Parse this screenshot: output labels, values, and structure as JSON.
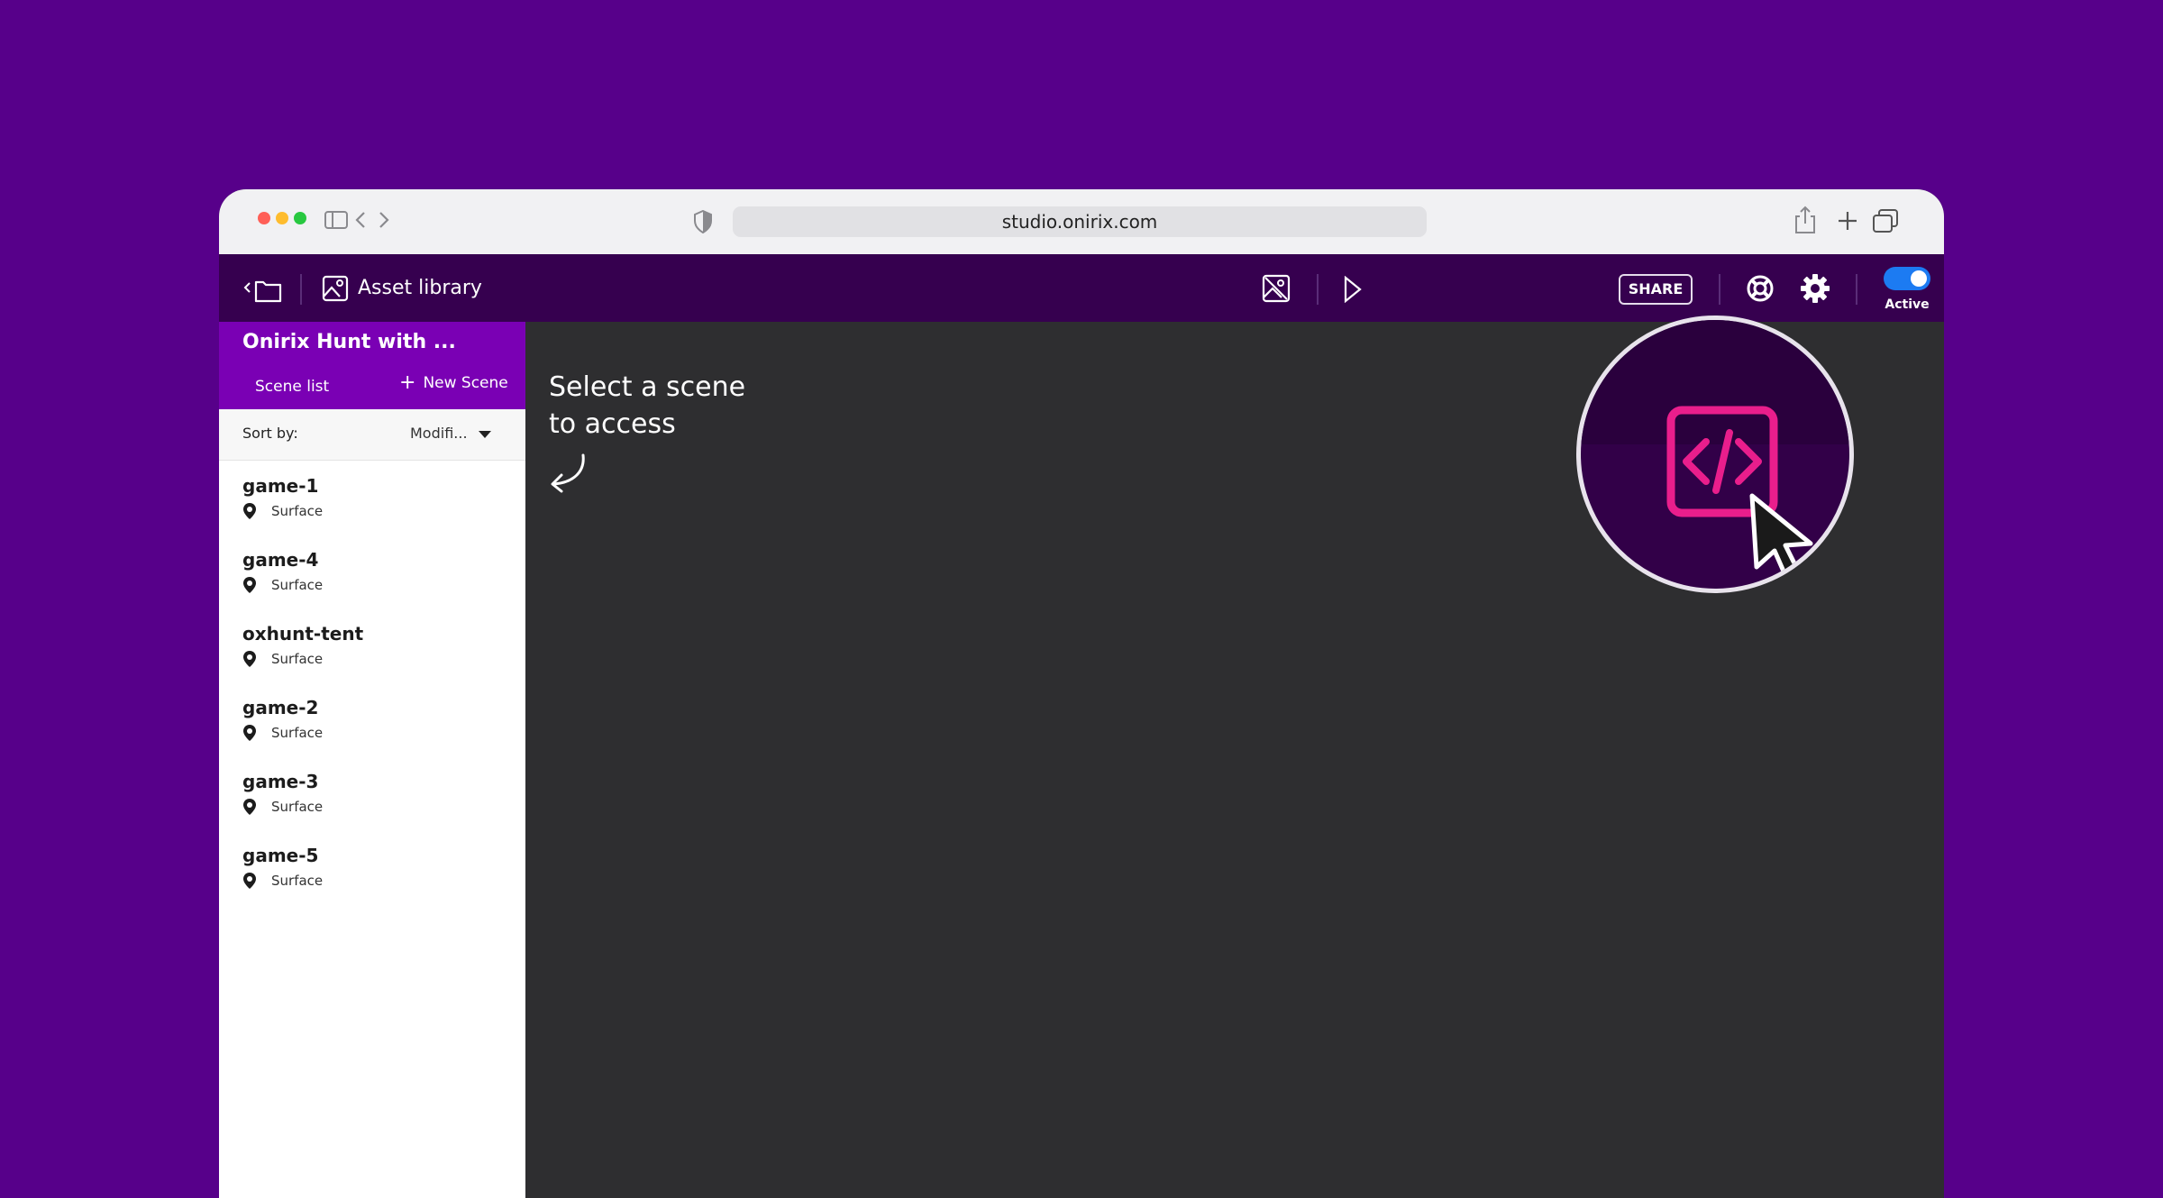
{
  "browser": {
    "url": "studio.onirix.com",
    "traffic_lights": [
      "#ff5f57",
      "#febc2e",
      "#28c840"
    ]
  },
  "toolbar": {
    "asset_library_label": "Asset library",
    "share_label": "SHARE",
    "active_toggle": {
      "label": "Active",
      "on": true
    }
  },
  "sidebar": {
    "project_title": "Onirix Hunt with ...",
    "scene_list_label": "Scene list",
    "new_scene_label": "New Scene",
    "sort_label": "Sort by:",
    "sort_value": "Modifi...",
    "scenes": [
      {
        "name": "game-1",
        "type": "Surface"
      },
      {
        "name": "game-4",
        "type": "Surface"
      },
      {
        "name": "oxhunt-tent",
        "type": "Surface"
      },
      {
        "name": "game-2",
        "type": "Surface"
      },
      {
        "name": "game-3",
        "type": "Surface"
      },
      {
        "name": "game-5",
        "type": "Surface"
      }
    ]
  },
  "main": {
    "hint_line1": "Select a scene",
    "hint_line2": "to access"
  },
  "colors": {
    "background": "#57008a",
    "toolbar": "#36004f",
    "sidebar_header": "#7a00b4",
    "accent_pink": "#e91e8c",
    "toggle_blue": "#1c7bf2"
  }
}
